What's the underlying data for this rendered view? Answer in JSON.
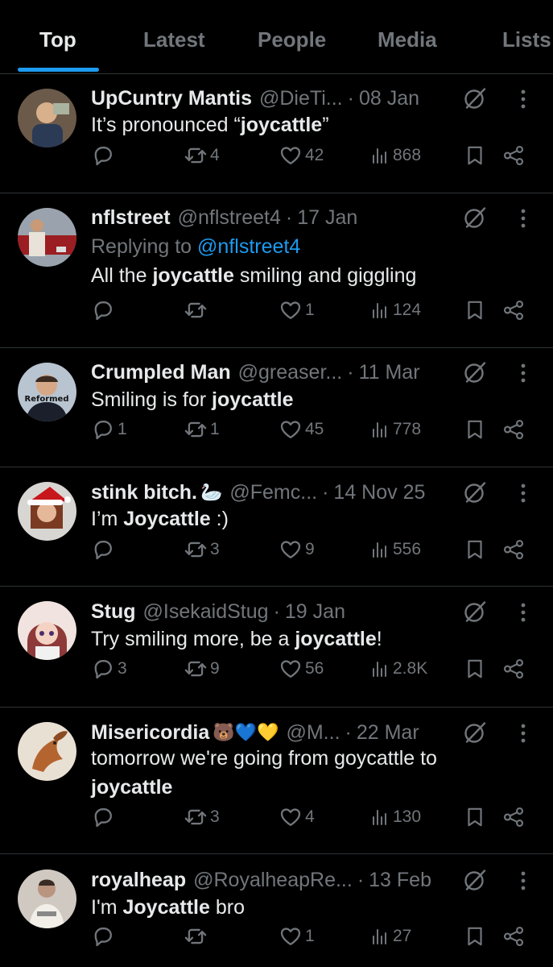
{
  "tabs": [
    "Top",
    "Latest",
    "People",
    "Media",
    "Lists"
  ],
  "active_tab": "Top",
  "colors": {
    "background": "#000000",
    "text": "#e7e9ea",
    "secondary": "#71767b",
    "accent": "#1d9bf0",
    "divider": "#2f3336"
  },
  "posts": [
    {
      "name": "UpCuntry Mantis",
      "handle": "@DieTi...",
      "date": "08 Jan",
      "lines": [
        {
          "pre": "It’s pronounced “",
          "bold": "joycattle",
          "post": "”"
        }
      ],
      "replies": "",
      "reposts": "4",
      "likes": "42",
      "views": "868"
    },
    {
      "name": "nflstreet",
      "handle": "@nflstreet4",
      "date": "17 Jan",
      "replying_prefix": "Replying to ",
      "replying_to": "@nflstreet4",
      "lines": [
        {
          "pre": "All the ",
          "bold": "joycattle",
          "post": " smiling and giggling"
        }
      ],
      "replies": "",
      "reposts": "",
      "likes": "1",
      "views": "124"
    },
    {
      "name": "Crumpled Man",
      "handle": "@greaser...",
      "date": "11 Mar",
      "avatar_text": "Reformed",
      "lines": [
        {
          "pre": "Smiling is for ",
          "bold": "joycattle",
          "post": ""
        }
      ],
      "replies": "1",
      "reposts": "1",
      "likes": "45",
      "views": "778"
    },
    {
      "name": "stink bitch.",
      "name_emoji": "🦢",
      "handle": "@Femc...",
      "date": "14 Nov 25",
      "lines": [
        {
          "pre": "I’m ",
          "bold": "Joycattle",
          "post": " :)"
        }
      ],
      "replies": "",
      "reposts": "3",
      "likes": "9",
      "views": "556"
    },
    {
      "name": "Stug",
      "handle": "@IsekaidStug",
      "date": "19 Jan",
      "lines": [
        {
          "pre": "Try smiling more, be a ",
          "bold": "joycattle",
          "post": "!"
        }
      ],
      "replies": "3",
      "reposts": "9",
      "likes": "56",
      "views": "2.8K"
    },
    {
      "name": "Misericordia",
      "name_emoji": "🐻💙💛",
      "handle": "@M...",
      "date": "22 Mar",
      "lines": [
        {
          "pre": "tomorrow we're going from goycattle to",
          "bold": "",
          "post": ""
        },
        {
          "pre": "",
          "bold": "joycattle",
          "post": ""
        }
      ],
      "replies": "",
      "reposts": "3",
      "likes": "4",
      "views": "130"
    },
    {
      "name": "royalheap",
      "handle": "@RoyalheapRe...",
      "date": "13 Feb",
      "lines": [
        {
          "pre": "I'm ",
          "bold": "Joycattle",
          "post": " bro"
        }
      ],
      "replies": "",
      "reposts": "",
      "likes": "1",
      "views": "27"
    }
  ]
}
